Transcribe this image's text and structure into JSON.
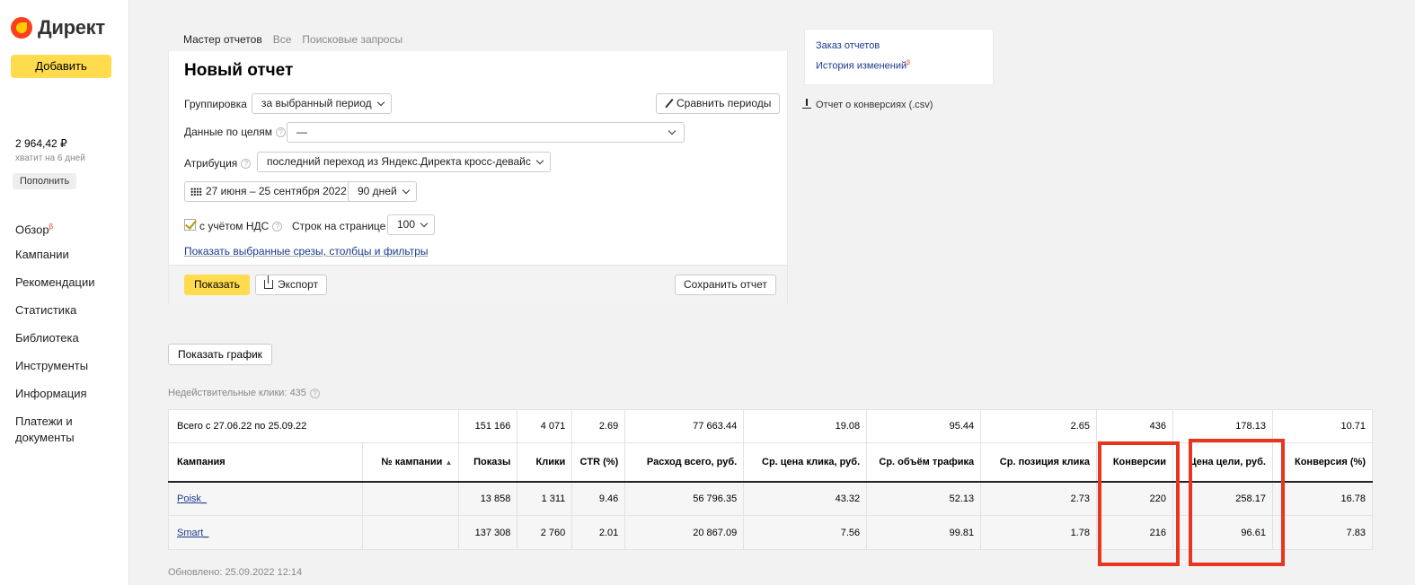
{
  "sidebar": {
    "logo": "Директ",
    "add_button": "Добавить",
    "balance": "2 964,42 ₽",
    "balance_note": "хватит на 6 дней",
    "topup_button": "Пополнить",
    "nav": [
      "Обзор",
      "Кампании",
      "Рекомендации",
      "Статистика",
      "Библиотека",
      "Инструменты",
      "Информация",
      "Платежи и документы"
    ],
    "nav_badge": "β"
  },
  "tabs": [
    "Мастер отчетов",
    "Все",
    "Поисковые запросы"
  ],
  "report": {
    "title": "Новый отчет",
    "grouping_label": "Группировка",
    "grouping_value": "за выбранный период",
    "compare_button": "Сравнить периоды",
    "goals_label": "Данные по целям",
    "goals_value": "—",
    "attribution_label": "Атрибуция",
    "attribution_value": "последний переход из Яндекс.Директа кросс-девайс",
    "date_range": "27 июня – 25 сентября 2022",
    "period_value": "90 дней",
    "vat_label": "с учётом НДС",
    "vat_checked": true,
    "rows_label": "Строк на странице",
    "rows_value": "100",
    "filters_link": "Показать выбранные срезы, столбцы и фильтры",
    "show_button": "Показать",
    "export_button": "Экспорт",
    "save_button": "Сохранить отчет"
  },
  "right_links": {
    "order_reports": "Заказ отчетов",
    "change_history": "История изменений",
    "change_history_badge": "β",
    "conversions_csv": "Отчет о конверсиях (.csv)"
  },
  "show_chart_button": "Показать график",
  "invalid_clicks": "Недействительные клики: 435",
  "table": {
    "total_label": "Всего с 27.06.22 по 25.09.22",
    "totals": [
      "151 166",
      "4 071",
      "2.69",
      "77 663.44",
      "19.08",
      "95.44",
      "2.65",
      "436",
      "178.13",
      "10.71"
    ],
    "columns": [
      "Кампания",
      "№ кампании",
      "Показы",
      "Клики",
      "CTR (%)",
      "Расход всего, руб.",
      "Ср. цена клика, руб.",
      "Ср. объём трафика",
      "Ср. позиция клика",
      "Конверсии",
      "Цена цели, руб.",
      "Конверсия (%)"
    ],
    "sort_indicator": "▲",
    "rows": [
      {
        "campaign": "Poisk_",
        "number": "",
        "values": [
          "13 858",
          "1 311",
          "9.46",
          "56 796.35",
          "43.32",
          "52.13",
          "2.73",
          "220",
          "258.17",
          "16.78"
        ]
      },
      {
        "campaign": "Smart_",
        "number": "",
        "values": [
          "137 308",
          "2 760",
          "2.01",
          "20 867.09",
          "7.56",
          "99.81",
          "1.78",
          "216",
          "96.61",
          "7.83"
        ]
      }
    ]
  },
  "updated": "Обновлено: 25.09.2022 12:14",
  "colors": {
    "accent_yellow": "#ffdb4d",
    "highlight_red": "#e8351f",
    "link_blue": "#1a3a8c"
  }
}
